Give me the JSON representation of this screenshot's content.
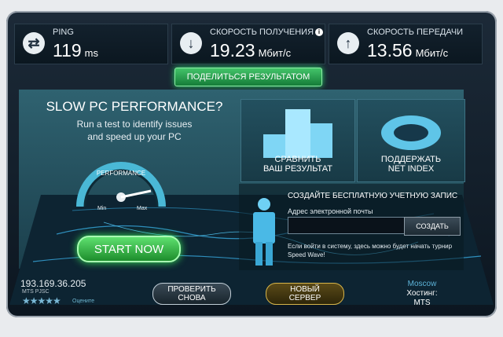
{
  "stats": {
    "ping": {
      "label": "PING",
      "value": "119",
      "unit": "ms",
      "icon": "exchange-arrows-icon"
    },
    "download": {
      "label": "СКОРОСТЬ ПОЛУЧЕНИЯ",
      "value": "19.23",
      "unit": "Мбит/с",
      "icon": "download-arrow-icon",
      "info": "i"
    },
    "upload": {
      "label": "СКОРОСТЬ ПЕРЕДАЧИ",
      "value": "13.56",
      "unit": "Мбит/с",
      "icon": "upload-arrow-icon"
    }
  },
  "share_label": "ПОДЕЛИТЬСЯ РЕЗУЛЬТАТОМ",
  "promo": {
    "title": "SLOW PC PERFORMANCE?",
    "line1": "Run a test to identify issues",
    "line2": "and speed up your PC",
    "gauge_label": "PERFORMANCE",
    "gauge_min": "Min",
    "gauge_max": "Max",
    "start_label": "START NOW"
  },
  "cards": {
    "compare": {
      "line1": "СРАВНИТЬ",
      "line2": "ВАШ РЕЗУЛЬТАТ"
    },
    "netindex": {
      "line1": "ПОДДЕРЖАТЬ",
      "line2": "NET INDEX"
    }
  },
  "signup": {
    "title": "СОЗДАЙТЕ БЕСПЛАТНУЮ УЧЕТНУЮ ЗАПИС",
    "email_label": "Адрес электронной почты",
    "email_value": "",
    "create_label": "СОЗДАТЬ",
    "note": "Если войти в систему, здесь можно будет начать турнир Speed Wave!"
  },
  "footer": {
    "ip": "193.169.36.205",
    "isp": "MTS PJSC",
    "stars": "★★★★★",
    "rate_label": "Оцените",
    "retest": {
      "line1": "ПРОВЕРИТЬ",
      "line2": "СНОВА"
    },
    "new_server": {
      "line1": "НОВЫЙ",
      "line2": "СЕРВЕР"
    },
    "server": {
      "city": "Moscow",
      "hosting": "Хостинг:",
      "host": "MTS"
    }
  },
  "colors": {
    "accent_green": "#3bea5a",
    "new_server_gold": "#d8b54a",
    "city_blue": "#5db3d8"
  }
}
